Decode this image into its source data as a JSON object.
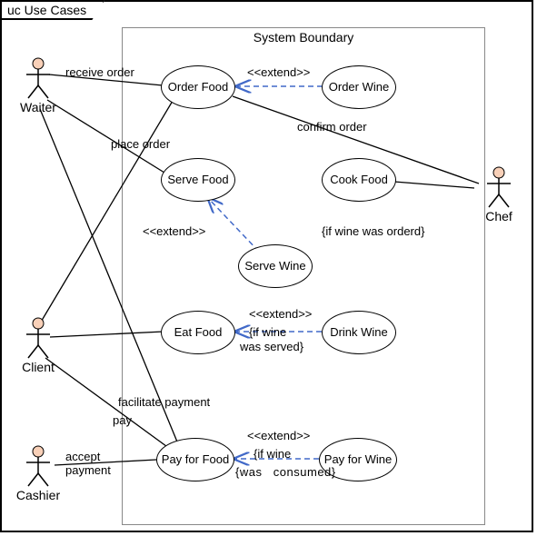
{
  "frame": {
    "title": "uc Use Cases"
  },
  "boundary": {
    "title": "System Boundary"
  },
  "actors": {
    "waiter": {
      "label": "Waiter"
    },
    "client": {
      "label": "Client"
    },
    "cashier": {
      "label": "Cashier"
    },
    "chef": {
      "label": "Chef"
    }
  },
  "usecases": {
    "order_food": {
      "label": "Order Food"
    },
    "order_wine": {
      "label": "Order Wine"
    },
    "serve_food": {
      "label": "Serve Food"
    },
    "cook_food": {
      "label": "Cook Food"
    },
    "serve_wine": {
      "label": "Serve Wine"
    },
    "eat_food": {
      "label": "Eat Food"
    },
    "drink_wine": {
      "label": "Drink Wine"
    },
    "pay_food": {
      "label": "Pay for Food"
    },
    "pay_wine": {
      "label": "Pay for Wine"
    }
  },
  "edges": {
    "receive_order": "receive order",
    "place_order": "place order",
    "confirm_order": "confirm order",
    "facilitate_payment": "facilitate payment",
    "pay": "pay",
    "accept_payment": "accept payment",
    "ext1": "<<extend>>",
    "ext2": "<<extend>>",
    "ext3": "<<extend>>",
    "ext4": "<<extend>>",
    "guard_wine_ordered": "{if wine was orderd}",
    "guard_wine_served_a": "{if wine",
    "guard_wine_served_b": "was served}",
    "guard_wine_consumed_a": "{if wine",
    "guard_wine_consumed_b": "was consumed}"
  }
}
